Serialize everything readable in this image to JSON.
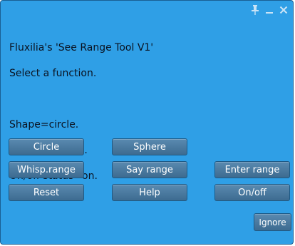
{
  "dialog": {
    "message_lines": [
      "Fluxilia's 'See Range Tool V1'",
      "Select a function.",
      "",
      "Shape=circle.",
      "Range=10.0 m.",
      "On/off status=on."
    ]
  },
  "titlebar": {
    "icons": [
      "pin-icon",
      "minimize-icon",
      "close-icon"
    ]
  },
  "buttons": {
    "circle": "Circle",
    "sphere": "Sphere",
    "whisp_range": "Whisp.range",
    "say_range": "Say range",
    "enter_range": "Enter range",
    "reset": "Reset",
    "help": "Help",
    "on_off": "On/off",
    "ignore": "Ignore"
  },
  "colors": {
    "dialog_bg": "#2f9fe6",
    "button_bg": "#4a78a0",
    "button_text": "#ffffff"
  }
}
